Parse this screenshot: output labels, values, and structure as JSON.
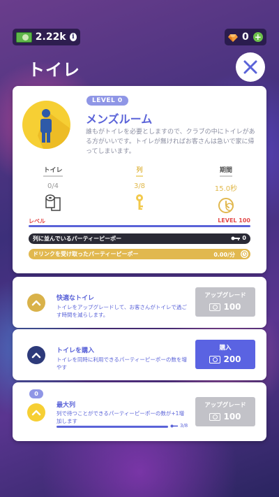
{
  "topbar": {
    "cash_value": "2.22k",
    "gem_value": "0"
  },
  "title": "トイレ",
  "room": {
    "level_label": "LEVEL 0",
    "name": "メンズルーム",
    "description": "誰もがトイレを必要としますので、クラブの中にトイレがある方がいいです。トイレが無ければお客さんは急いで家に帰ってしまいます。",
    "stats": [
      {
        "label": "トイレ",
        "value": "0/4",
        "icon": "toilet-paper-icon"
      },
      {
        "label": "列",
        "value": "3/8",
        "icon": "key-icon"
      },
      {
        "label": "期間",
        "value": "15.0秒",
        "icon": "timer-icon"
      }
    ],
    "level_left": "レベル",
    "level_right": "LEVEL 100",
    "level_progress": 1.0,
    "queue_label": "列に並んでいるパーティーピーポー",
    "queue_value": "0",
    "drink_label": "ドリンクを受け取ったパーティーピーポー",
    "drink_value": "0.00/分"
  },
  "upgrades": [
    {
      "title": "快適なトイレ",
      "description": "トイレをアップグレードして、お客さんがトイレで過ごす時間を減らします。",
      "button_label": "アップグレード",
      "cost": "100",
      "state": "disabled",
      "icon": "chevron-up-icon"
    },
    {
      "title": "トイレを購入",
      "description": "トイレを同時に利用できるパーティーピーポーの数を増やす",
      "button_label": "購入",
      "cost": "200",
      "state": "enabled",
      "icon": "chevron-up-icon"
    },
    {
      "level_badge": "0",
      "title": "最大列",
      "description": "列で待つことができるパーティーピーポーの数が+1増加します",
      "progress_value": "3/8",
      "progress": 0.375,
      "button_label": "アップグレード",
      "cost": "100",
      "state": "disabled",
      "icon": "chevron-up-icon"
    }
  ],
  "colors": {
    "accent": "#5a63d8",
    "gold": "#e1b84f",
    "navy": "#2d3a7a",
    "disabled": "#c2c2c8"
  }
}
